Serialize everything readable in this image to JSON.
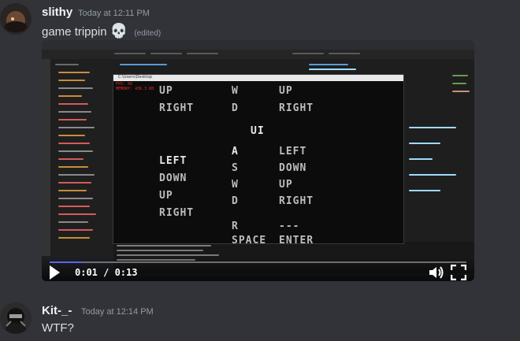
{
  "messages": [
    {
      "username": "slithy",
      "timestamp": "Today at 12:11 PM",
      "text": "game trippin",
      "emoji": "💀",
      "edited": "(edited)",
      "video": {
        "time_display": "0:01 / 0:13",
        "progress": 0.08,
        "game": {
          "title_bar": "C:\\Users\\Desktop",
          "header_red_1": "FPS: 60",
          "header_red_2": "MEMORY: 436.3 KB",
          "col1": [
            "UP",
            "RIGHT",
            "",
            "",
            "LEFT",
            "DOWN",
            "UP",
            "RIGHT"
          ],
          "col2": [
            "W",
            "D",
            "",
            "A",
            "S",
            "W",
            "D",
            "",
            "R",
            "SPACE"
          ],
          "col3": [
            "UP",
            "RIGHT",
            "",
            "LEFT",
            "DOWN",
            "UP",
            "RIGHT",
            "",
            "---",
            "ENTER"
          ],
          "center_label": "UI"
        }
      }
    },
    {
      "username": "Kit-_-",
      "timestamp": "Today at 12:14 PM",
      "text": "WTF?"
    }
  ],
  "colors": {
    "background": "#313338",
    "accent": "#5865f2"
  }
}
